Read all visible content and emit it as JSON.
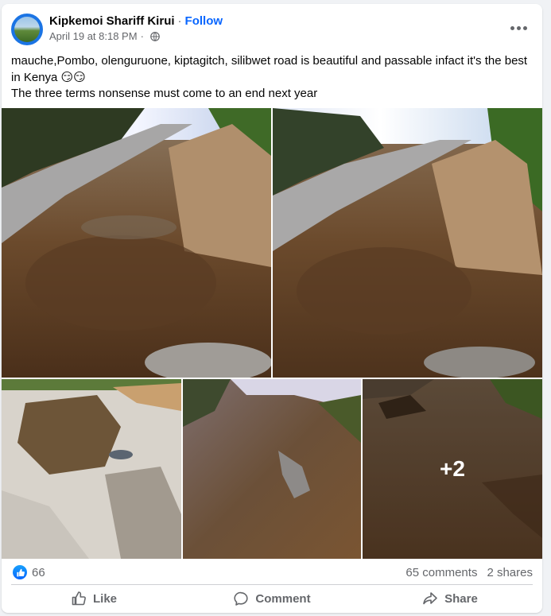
{
  "post": {
    "author": "Kipkemoi Shariff Kirui",
    "separator": "·",
    "follow_label": "Follow",
    "timestamp": "April 19 at 8:18 PM",
    "timestamp_separator": "·",
    "audience_icon": "globe-icon",
    "text_line1": "mauche,Pombo, olenguruone, kiptagitch, silibwet road is beautiful and passable infact it's the best in Kenya",
    "text_emoji": "😏😏",
    "text_line2": "The three terms nonsense must come to an end next year"
  },
  "photos": {
    "more_count_label": "+2"
  },
  "stats": {
    "like_icon": "thumbs-up-icon",
    "reaction_count": "66",
    "comments_label": "65 comments",
    "shares_label": "2 shares"
  },
  "actions": {
    "like_label": "Like",
    "comment_label": "Comment",
    "share_label": "Share"
  },
  "colors": {
    "accent": "#0866ff",
    "secondary_text": "#65676b"
  }
}
